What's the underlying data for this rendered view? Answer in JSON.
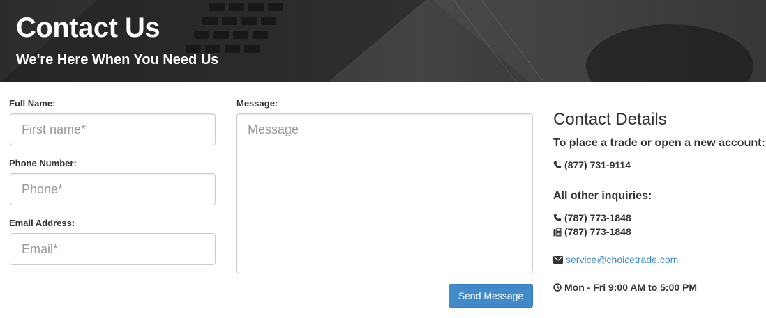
{
  "hero": {
    "title": "Contact Us",
    "subtitle": "We're Here When You Need Us"
  },
  "form": {
    "full_name": {
      "label": "Full Name:",
      "placeholder": "First name*"
    },
    "phone": {
      "label": "Phone Number:",
      "placeholder": "Phone*"
    },
    "email": {
      "label": "Email Address:",
      "placeholder": "Email*"
    },
    "message": {
      "label": "Message:",
      "placeholder": "Message"
    },
    "send_label": "Send Message"
  },
  "contact_details": {
    "heading": "Contact Details",
    "trade_heading": "To place a trade or open a new account:",
    "trade_phone": "(877) 731-9114",
    "other_heading": "All other inquiries:",
    "other_phone": "(787) 773-1848",
    "other_fax": "(787) 773-1848",
    "email": "service@choicetrade.com",
    "hours": "Mon - Fri 9:00 AM to 5:00 PM"
  },
  "colors": {
    "accent": "#428bca",
    "text": "#333333",
    "placeholder": "#999999"
  },
  "icons": [
    "phone-icon",
    "fax-icon",
    "envelope-icon",
    "clock-icon"
  ]
}
